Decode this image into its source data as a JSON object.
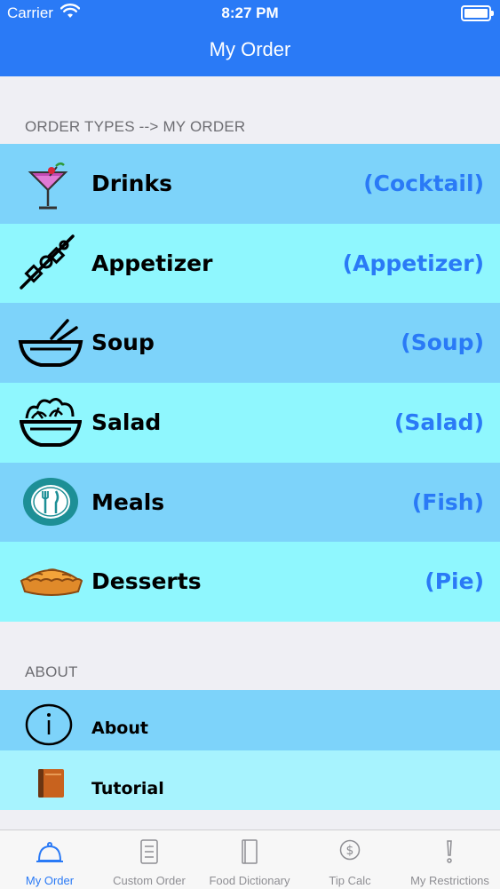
{
  "status_bar": {
    "carrier": "Carrier",
    "time": "8:27 PM"
  },
  "nav": {
    "title": "My Order"
  },
  "order_section": {
    "header": "ORDER TYPES --> MY ORDER"
  },
  "order_rows": [
    {
      "label": "Drinks",
      "detail": "(Cocktail)",
      "icon": "cocktail-icon",
      "bg": "#7dd3fa"
    },
    {
      "label": "Appetizer",
      "detail": "(Appetizer)",
      "icon": "skewer-icon",
      "bg": "#8ff7fe"
    },
    {
      "label": "Soup",
      "detail": "(Soup)",
      "icon": "soup-bowl-icon",
      "bg": "#7dd3fa"
    },
    {
      "label": "Salad",
      "detail": "(Salad)",
      "icon": "salad-bowl-icon",
      "bg": "#8ff7fe"
    },
    {
      "label": "Meals",
      "detail": "(Fish)",
      "icon": "plate-icon",
      "bg": "#7dd3fa"
    },
    {
      "label": "Desserts",
      "detail": "(Pie)",
      "icon": "pie-icon",
      "bg": "#8ff7fe"
    }
  ],
  "about_section": {
    "header": "ABOUT"
  },
  "about_rows": [
    {
      "label": "About",
      "icon": "info-icon",
      "bg": "#7dd3fa"
    },
    {
      "label": "Tutorial",
      "icon": "book-icon",
      "bg": "#a7f3fe"
    }
  ],
  "tabs": [
    {
      "label": "My Order",
      "icon": "cloche-icon",
      "active": true
    },
    {
      "label": "Custom Order",
      "icon": "list-icon",
      "active": false
    },
    {
      "label": "Food Dictionary",
      "icon": "dictionary-icon",
      "active": false
    },
    {
      "label": "Tip Calc",
      "icon": "dollar-icon",
      "active": false
    },
    {
      "label": "My Restrictions",
      "icon": "exclamation-icon",
      "active": false
    }
  ],
  "colors": {
    "accent": "#2a7af6",
    "row_dark": "#7dd3fa",
    "row_light": "#8ff7fe",
    "background": "#efeff4"
  }
}
